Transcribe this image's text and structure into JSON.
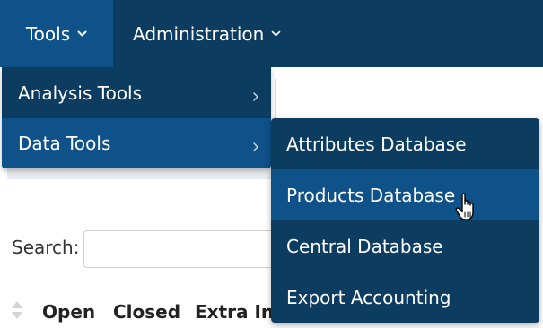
{
  "navbar": {
    "items": [
      {
        "label": "Tools",
        "icon": "chevron-down-icon",
        "active": true
      },
      {
        "label": "Administration",
        "icon": "chevron-down-icon",
        "active": false
      }
    ],
    "colors": {
      "background": "#0d3c61",
      "active": "#0f5289",
      "text": "#ffffff"
    }
  },
  "tools_menu": {
    "items": [
      {
        "label": "Analysis Tools",
        "icon": "chevron-right-icon"
      },
      {
        "label": "Data Tools",
        "icon": "chevron-right-icon",
        "active": true
      }
    ]
  },
  "data_tools_menu": {
    "items": [
      {
        "label": "Attributes Database"
      },
      {
        "label": "Products Database",
        "hovered": true
      },
      {
        "label": "Central Database"
      },
      {
        "label": "Export Accounting"
      }
    ]
  },
  "page": {
    "search_label": "Search:",
    "search_value": "",
    "table_headers": [
      "Open",
      "Closed",
      "Extra Inf"
    ],
    "sort_icon": "sort-icon"
  },
  "cursor": {
    "icon": "hand-pointer-icon"
  }
}
